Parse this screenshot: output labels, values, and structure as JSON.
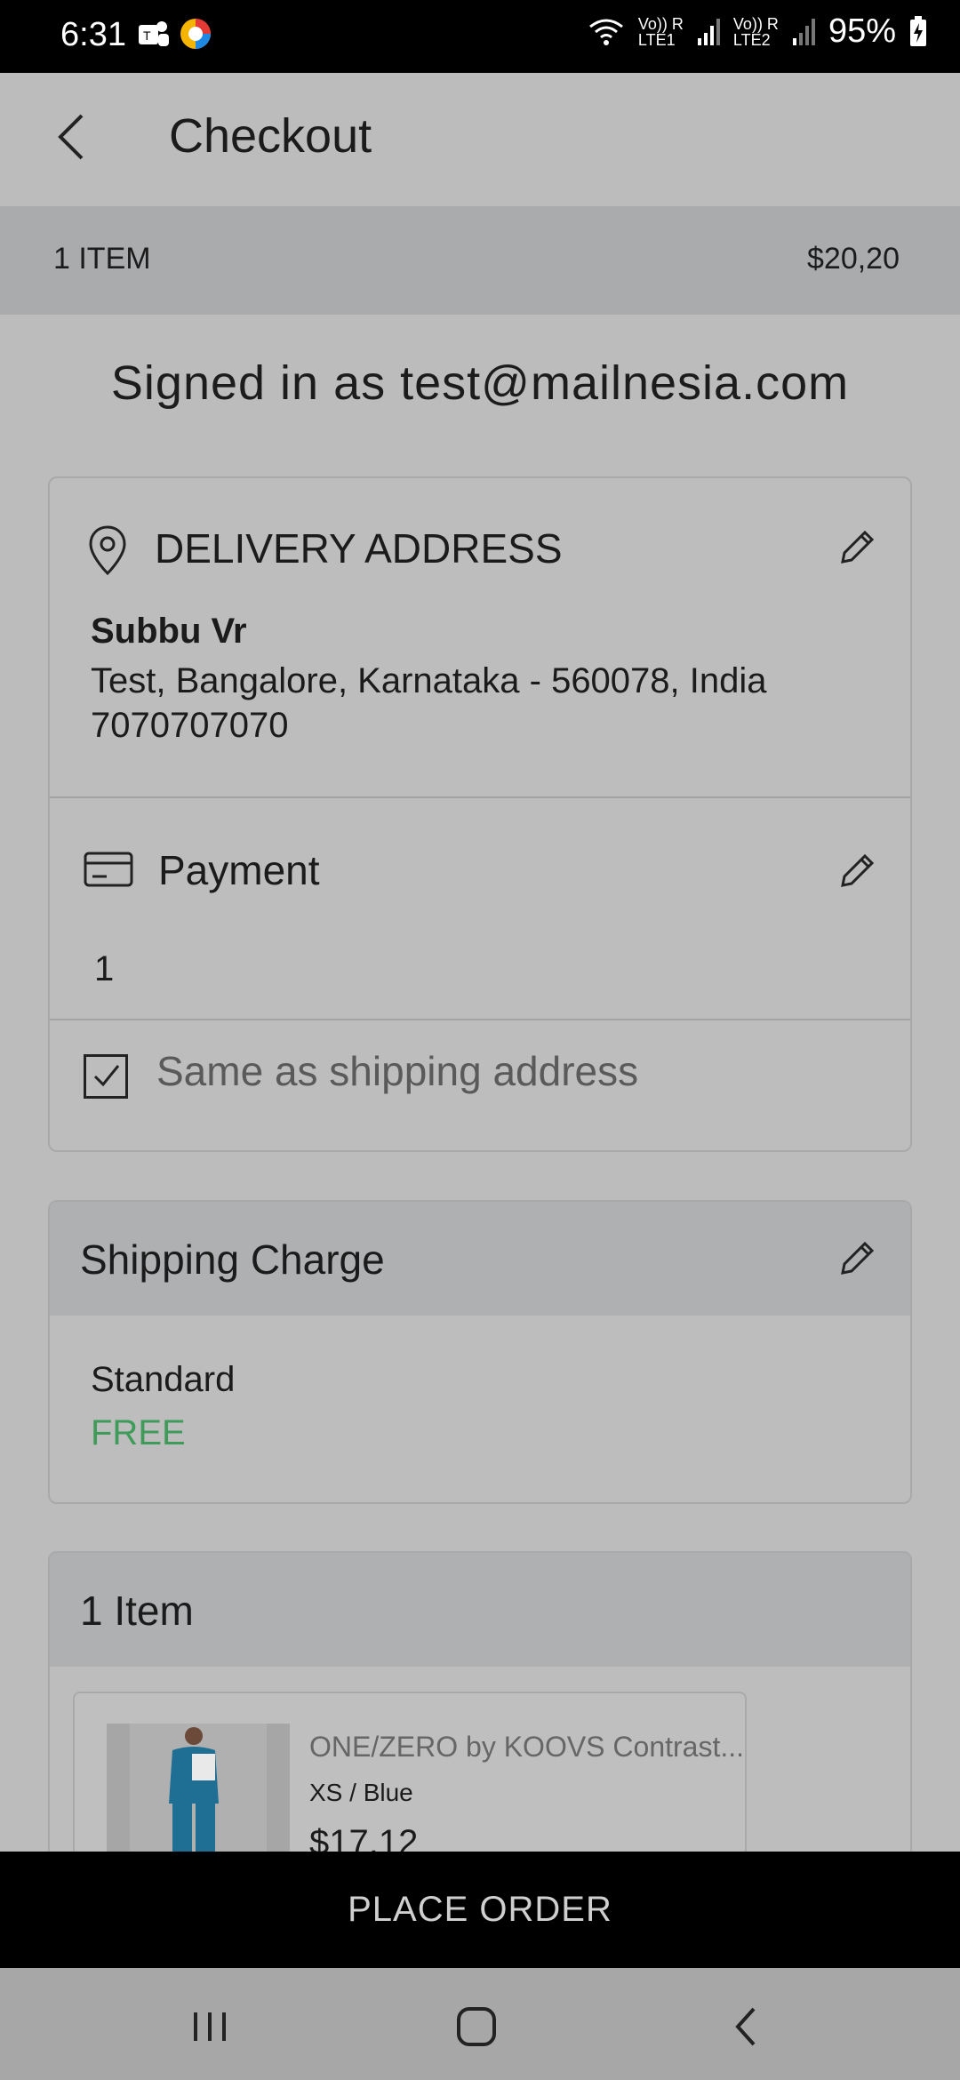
{
  "status_bar": {
    "time": "6:31",
    "network_1": "Vo)) R\nLTE1",
    "network_2": "Vo)) R\nLTE2",
    "battery": "95%"
  },
  "header": {
    "title": "Checkout"
  },
  "summary": {
    "item_count": "1 ITEM",
    "total": "$20,20"
  },
  "signed_in_text": "Signed in as test@mailnesia.com",
  "delivery": {
    "title": "DELIVERY ADDRESS",
    "name": "Subbu Vr",
    "address_line": "Test, Bangalore, Karnataka - 560078, India",
    "phone": "7070707070"
  },
  "payment": {
    "title": "Payment",
    "value": "1",
    "same_as_shipping_label": "Same as shipping address",
    "same_as_shipping_checked": true
  },
  "shipping": {
    "title": "Shipping Charge",
    "method": "Standard",
    "price": "FREE",
    "price_color": "#3f9b5a"
  },
  "items": {
    "title": "1 Item",
    "products": [
      {
        "name": "ONE/ZERO by KOOVS Contrast...",
        "variant": "XS / Blue",
        "price": "$17,12"
      }
    ]
  },
  "place_order_label": "PLACE ORDER",
  "colors": {
    "summary_bar": "#a9abad",
    "place_order_bg": "#000000",
    "background": "#bcbcbc"
  }
}
